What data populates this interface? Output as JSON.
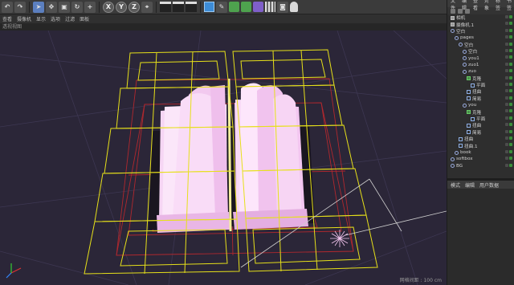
{
  "toolbar": {
    "axis_x": "X",
    "axis_y": "Y",
    "axis_z": "Z"
  },
  "viewport": {
    "menu": [
      "查看",
      "摄像机",
      "显示",
      "选项",
      "过滤",
      "面板"
    ],
    "header": "透视视图",
    "status": "网格间距 : 100 cm"
  },
  "right_panel": {
    "menu": [
      "文件",
      "编辑",
      "查看",
      "对象",
      "标签",
      "书签"
    ],
    "tree": [
      {
        "label": "相机",
        "indent": 0,
        "icon": "camera-icon",
        "kind": "gray"
      },
      {
        "label": "摄像机.1",
        "indent": 0,
        "icon": "camera-icon",
        "kind": "gray"
      },
      {
        "label": "空白",
        "indent": 0,
        "icon": "null-icon",
        "kind": "null"
      },
      {
        "label": "pages",
        "indent": 1,
        "icon": "null-icon",
        "kind": "null"
      },
      {
        "label": "空白",
        "indent": 2,
        "icon": "null-icon",
        "kind": "null"
      },
      {
        "label": "空白",
        "indent": 3,
        "icon": "null-icon",
        "kind": "null"
      },
      {
        "label": "you1",
        "indent": 3,
        "icon": "null-icon",
        "kind": "null"
      },
      {
        "label": "zuo1",
        "indent": 3,
        "icon": "null-icon",
        "kind": "null"
      },
      {
        "label": "zuo",
        "indent": 3,
        "icon": "null-icon",
        "kind": "null"
      },
      {
        "label": "克隆",
        "indent": 4,
        "icon": "cloner-icon",
        "kind": "green"
      },
      {
        "label": "平面",
        "indent": 5,
        "icon": "plane-icon",
        "kind": "normal"
      },
      {
        "label": "扭曲",
        "indent": 4,
        "icon": "deformer-icon",
        "kind": "normal"
      },
      {
        "label": "简易",
        "indent": 4,
        "icon": "effector-icon",
        "kind": "normal"
      },
      {
        "label": "you",
        "indent": 3,
        "icon": "null-icon",
        "kind": "null"
      },
      {
        "label": "克隆",
        "indent": 4,
        "icon": "cloner-icon",
        "kind": "green"
      },
      {
        "label": "平面",
        "indent": 5,
        "icon": "plane-icon",
        "kind": "normal"
      },
      {
        "label": "扭曲",
        "indent": 4,
        "icon": "deformer-icon",
        "kind": "normal"
      },
      {
        "label": "简易",
        "indent": 4,
        "icon": "effector-icon",
        "kind": "normal"
      },
      {
        "label": "扭曲",
        "indent": 2,
        "icon": "deformer-icon",
        "kind": "normal"
      },
      {
        "label": "扭曲.1",
        "indent": 2,
        "icon": "deformer-icon",
        "kind": "normal"
      },
      {
        "label": "book",
        "indent": 1,
        "icon": "null-icon",
        "kind": "null"
      },
      {
        "label": "softbox",
        "indent": 0,
        "icon": "null-icon",
        "kind": "null"
      },
      {
        "label": "BG",
        "indent": 0,
        "icon": "null-icon",
        "kind": "null"
      }
    ],
    "attr_tabs": [
      "模式",
      "编辑",
      "用户数据"
    ]
  },
  "colors": {
    "viewport_bg": "#2b2638",
    "wire_yellow": "#e6e01a",
    "wire_red": "#b0282e",
    "page_pink": "#f3c9f0"
  }
}
